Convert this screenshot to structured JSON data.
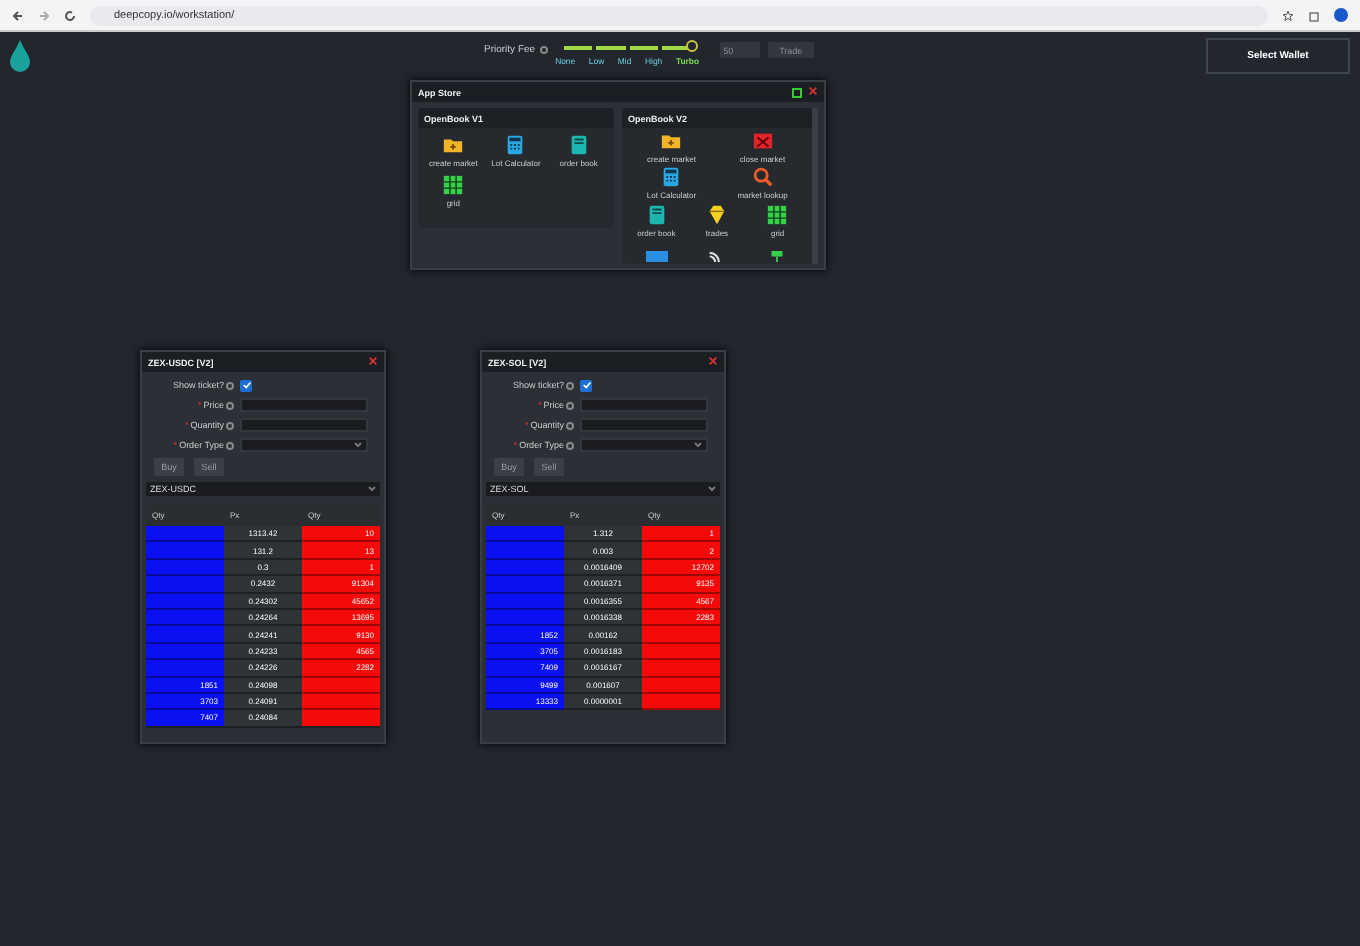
{
  "browser": {
    "url": "deepcopy.io/workstation/"
  },
  "header": {
    "priority_fee": {
      "label": "Priority Fee",
      "level": 1,
      "stops": [
        {
          "label": "None",
          "selected": false
        },
        {
          "label": "Low",
          "selected": false
        },
        {
          "label": "Mid",
          "selected": false
        },
        {
          "label": "High",
          "selected": false
        },
        {
          "label": "Turbo",
          "selected": true
        }
      ]
    },
    "amount": {
      "value": "50",
      "disabled": true
    },
    "trade_button": {
      "label": "Trade",
      "disabled": true
    },
    "wallet_button": "Select Wallet"
  },
  "app_store": {
    "title": "App Store",
    "panels": [
      {
        "title": "OpenBook V1",
        "apps": [
          {
            "label": "create market",
            "kind": "folder"
          },
          {
            "label": "Lot Calculator",
            "kind": "calculator"
          },
          {
            "label": "order book",
            "kind": "book"
          },
          {
            "label": "grid",
            "kind": "grid"
          }
        ]
      },
      {
        "title": "OpenBook V2",
        "apps": [
          {
            "label": "create market",
            "kind": "folder"
          },
          {
            "label": "close market",
            "kind": "closebox"
          },
          {
            "label": "Lot Calculator",
            "kind": "calculator"
          },
          {
            "label": "market lookup",
            "kind": "magnifier"
          },
          {
            "label": "order book",
            "kind": "book"
          },
          {
            "label": "trades",
            "kind": "gem"
          },
          {
            "label": "grid",
            "kind": "grid"
          },
          {
            "kind": "bar"
          },
          {
            "kind": "feed"
          },
          {
            "kind": "network"
          }
        ]
      }
    ]
  },
  "order_windows": [
    {
      "title": "ZEX-USDC [V2]",
      "show_ticket": {
        "label": "Show ticket?",
        "checked": true
      },
      "fields": [
        {
          "required_mark": "*",
          "label": "Price",
          "kind": "text"
        },
        {
          "required_mark": "*",
          "label": "Quantity",
          "kind": "text"
        },
        {
          "required_mark": "*",
          "label": "Order Type",
          "kind": "select"
        }
      ],
      "buttons": [
        {
          "label": "Buy",
          "disabled": true
        },
        {
          "label": "Sell",
          "disabled": true
        }
      ],
      "market": "ZEX-USDC",
      "columns": [
        "Qty",
        "Px",
        "Qty"
      ],
      "rows": [
        [
          "",
          "1313.42",
          "10"
        ],
        [
          "",
          "131.2",
          "13"
        ],
        [
          "",
          "0.3",
          "1"
        ],
        [
          "",
          "0.2432",
          "91304"
        ],
        [
          "",
          "0.24302",
          "45652"
        ],
        [
          "",
          "0.24264",
          "13695"
        ],
        [
          "",
          "0.24241",
          "9130"
        ],
        [
          "",
          "0.24233",
          "4565"
        ],
        [
          "",
          "0.24226",
          "2282"
        ],
        [
          "1851",
          "0.24098",
          ""
        ],
        [
          "3703",
          "0.24091",
          ""
        ],
        [
          "7407",
          "0.24084",
          ""
        ]
      ]
    },
    {
      "title": "ZEX-SOL [V2]",
      "show_ticket": {
        "label": "Show ticket?",
        "checked": true
      },
      "fields": [
        {
          "required_mark": "*",
          "label": "Price",
          "kind": "text"
        },
        {
          "required_mark": "*",
          "label": "Quantity",
          "kind": "text"
        },
        {
          "required_mark": "*",
          "label": "Order Type",
          "kind": "select"
        }
      ],
      "buttons": [
        {
          "label": "Buy",
          "disabled": true
        },
        {
          "label": "Sell",
          "disabled": true
        }
      ],
      "market": "ZEX-SOL",
      "columns": [
        "Qty",
        "Px",
        "Qty"
      ],
      "rows": [
        [
          "",
          "1.312",
          "1"
        ],
        [
          "",
          "0.003",
          "2"
        ],
        [
          "",
          "0.0016409",
          "12702"
        ],
        [
          "",
          "0.0016371",
          "9135"
        ],
        [
          "",
          "0.0016355",
          "4567"
        ],
        [
          "",
          "0.0016338",
          "2283"
        ],
        [
          "1852",
          "0.00162",
          ""
        ],
        [
          "3705",
          "0.0016183",
          ""
        ],
        [
          "7409",
          "0.0016167",
          ""
        ],
        [
          "9499",
          "0.001607",
          ""
        ],
        [
          "13333",
          "0.0000001",
          ""
        ]
      ]
    }
  ]
}
